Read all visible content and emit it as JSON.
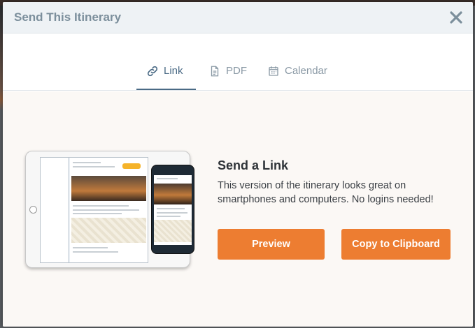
{
  "modal": {
    "title": "Send This Itinerary",
    "close_icon": "close-icon"
  },
  "tabs": [
    {
      "label": "Link",
      "icon": "link-icon",
      "active": true
    },
    {
      "label": "PDF",
      "icon": "document-icon",
      "active": false
    },
    {
      "label": "Calendar",
      "icon": "calendar-icon",
      "active": false
    }
  ],
  "panel": {
    "title": "Send a Link",
    "description": "This version of the itinerary looks great on smartphones and computers. No logins needed!",
    "preview_label": "Preview",
    "copy_label": "Copy to Clipboard"
  },
  "colors": {
    "accent": "#ed7d31",
    "active_tab": "#4a6a85",
    "header_bg": "#eef2f5",
    "content_bg": "#fbf8f5"
  }
}
